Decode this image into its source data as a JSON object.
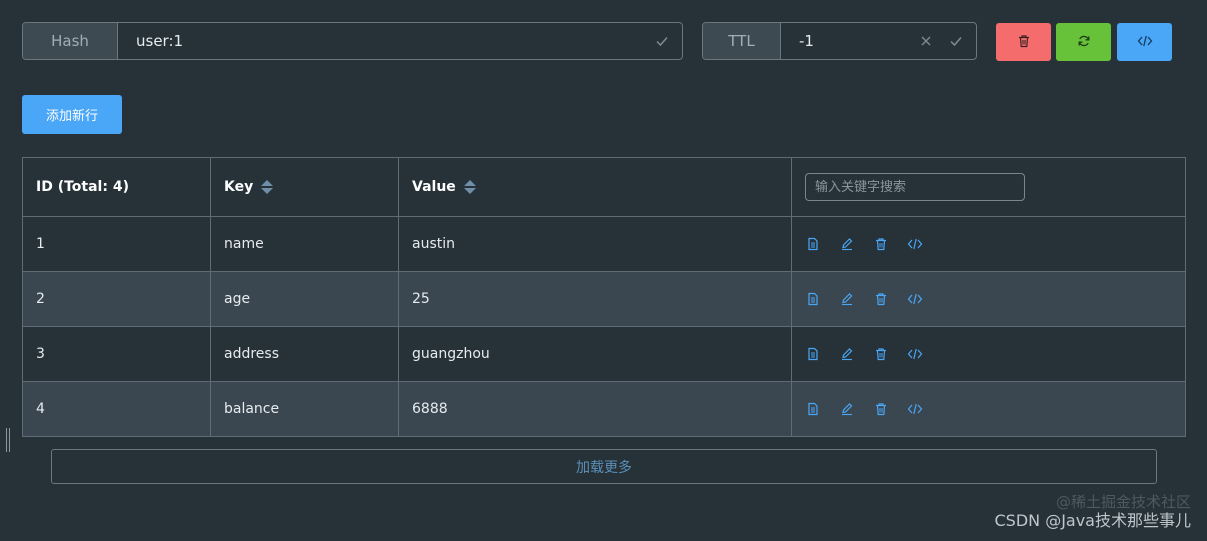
{
  "header": {
    "type_label": "Hash",
    "key_value": "user:1",
    "ttl_label": "TTL",
    "ttl_value": "-1"
  },
  "actions": {
    "delete_icon": "trash-icon",
    "refresh_icon": "refresh-icon",
    "code_icon": "code-icon",
    "colors": {
      "delete": "#f56c6c",
      "refresh": "#67c23a",
      "code": "#4aa6f7"
    }
  },
  "toolbar": {
    "add_row_label": "添加新行"
  },
  "table": {
    "columns": {
      "id": "ID (Total: 4)",
      "key": "Key",
      "value": "Value"
    },
    "search_placeholder": "输入关键字搜索",
    "rows": [
      {
        "id": "1",
        "key": "name",
        "value": "austin"
      },
      {
        "id": "2",
        "key": "age",
        "value": "25"
      },
      {
        "id": "3",
        "key": "address",
        "value": "guangzhou"
      },
      {
        "id": "4",
        "key": "balance",
        "value": "6888"
      }
    ],
    "row_action_icons": [
      "document-icon",
      "edit-icon",
      "delete-icon",
      "code-icon"
    ]
  },
  "footer": {
    "load_more_label": "加载更多"
  },
  "watermark": {
    "main": "CSDN @Java技术那些事儿",
    "ghost": "@稀土掘金技术社区"
  }
}
